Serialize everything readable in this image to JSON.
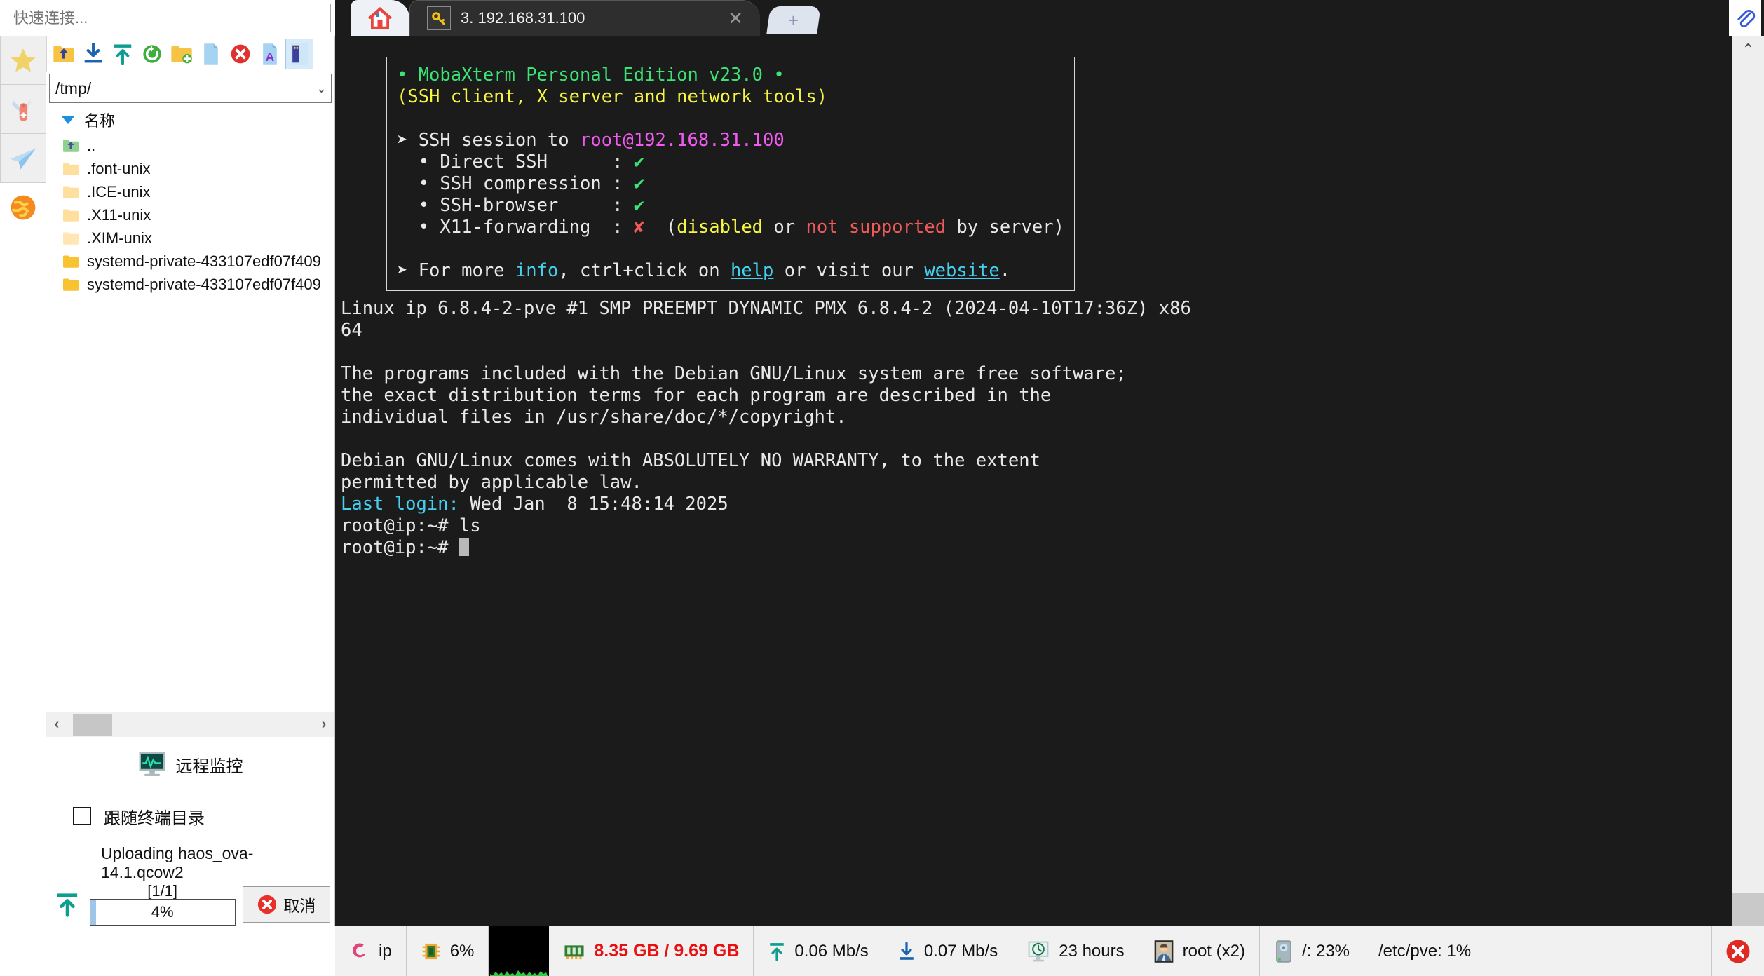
{
  "quick_connect": {
    "placeholder": "快速连接..."
  },
  "tabbar": {
    "home_tab_name": "home-tab",
    "active_tab_label": "3. 192.168.31.100",
    "close_label": "✕",
    "new_tab_label": "+"
  },
  "rail": {
    "items": [
      {
        "name": "favorites",
        "icon": "star-icon"
      },
      {
        "name": "tools",
        "icon": "swiss-army-knife-icon"
      },
      {
        "name": "send",
        "icon": "paper-plane-icon"
      },
      {
        "name": "globe",
        "icon": "globe-icon"
      }
    ]
  },
  "sftp": {
    "toolbar": [
      {
        "name": "go-up-folder",
        "icon": "folder-up-icon"
      },
      {
        "name": "download",
        "icon": "download-icon"
      },
      {
        "name": "upload",
        "icon": "upload-icon"
      },
      {
        "name": "refresh",
        "icon": "refresh-icon"
      },
      {
        "name": "new-folder",
        "icon": "new-folder-icon"
      },
      {
        "name": "new-file",
        "icon": "new-file-icon"
      },
      {
        "name": "delete",
        "icon": "delete-icon"
      },
      {
        "name": "text-mode",
        "icon": "text-file-icon"
      },
      {
        "name": "view-toggle",
        "icon": "panel-toggle-icon"
      }
    ],
    "path": "/tmp/",
    "column_header": "名称",
    "files": [
      {
        "name": "..",
        "kind": "parent"
      },
      {
        "name": ".font-unix",
        "kind": "folder-light"
      },
      {
        "name": ".ICE-unix",
        "kind": "folder-light"
      },
      {
        "name": ".X11-unix",
        "kind": "folder-light"
      },
      {
        "name": ".XIM-unix",
        "kind": "folder-light"
      },
      {
        "name": "systemd-private-433107edf07f409",
        "kind": "folder"
      },
      {
        "name": "systemd-private-433107edf07f409",
        "kind": "folder"
      }
    ],
    "hscroll": {
      "left": "‹",
      "right": "›"
    },
    "monitor_label": "远程监控",
    "follow_terminal_label": "跟随终端目录",
    "follow_terminal_checked": false
  },
  "upload": {
    "title": "Uploading haos_ova-14.1.qcow2",
    "count": "[1/1]",
    "percent_label": "4%",
    "percent_value": 4,
    "cancel_label": "取消"
  },
  "terminal": {
    "banner": {
      "title": "• MobaXterm Personal Edition v23.0 •",
      "subtitle": "(SSH client, X server and network tools)",
      "session_prefix": "➤ SSH session to ",
      "session_host": "root@192.168.31.100",
      "rows": [
        {
          "label": "• Direct SSH",
          "pad": "      ",
          "value": "✔",
          "state": "ok",
          "note": ""
        },
        {
          "label": "• SSH compression",
          "pad": " ",
          "value": "✔",
          "state": "ok",
          "note": ""
        },
        {
          "label": "• SSH-browser",
          "pad": "     ",
          "value": "✔",
          "state": "ok",
          "note": ""
        },
        {
          "label": "• X11-forwarding",
          "pad": "  ",
          "value": "✘",
          "state": "bad",
          "note": "(disabled or not supported by server)"
        }
      ],
      "footer_pre": "➤ For more ",
      "footer_info": "info",
      "footer_mid": ", ctrl+click on ",
      "footer_help": "help",
      "footer_mid2": " or visit our ",
      "footer_site": "website",
      "footer_end": "."
    },
    "uname_line1": "Linux ip 6.8.4-2-pve #1 SMP PREEMPT_DYNAMIC PMX 6.8.4-2 (2024-04-10T17:36Z) x86_",
    "uname_line2": "64",
    "motd": [
      "The programs included with the Debian GNU/Linux system are free software;",
      "the exact distribution terms for each program are described in the",
      "individual files in /usr/share/doc/*/copyright.",
      "",
      "Debian GNU/Linux comes with ABSOLUTELY NO WARRANTY, to the extent",
      "permitted by applicable law."
    ],
    "last_login_label": "Last login:",
    "last_login_value": " Wed Jan  8 15:48:14 2025",
    "prompt": "root@ip:~# ",
    "command": "ls",
    "prompt2": "root@ip:~# "
  },
  "statusbar": {
    "host": "ip",
    "cpu": "6%",
    "memory": "8.35 GB / 9.69 GB",
    "upload_speed": "0.06 Mb/s",
    "download_speed": "0.07 Mb/s",
    "uptime": "23 hours",
    "users": "root (x2)",
    "disk_root": "/: 23%",
    "disk_etc_pve": "/etc/pve: 1%"
  },
  "colors": {
    "terminal_bg": "#1b1b1b",
    "green": "#3ae374",
    "yellow": "#f5f543",
    "magenta": "#ef5bef",
    "cyan": "#44d0f0",
    "red": "#f05a5a",
    "mem_red": "#e81010",
    "accent_blue": "#1e8fe0"
  }
}
